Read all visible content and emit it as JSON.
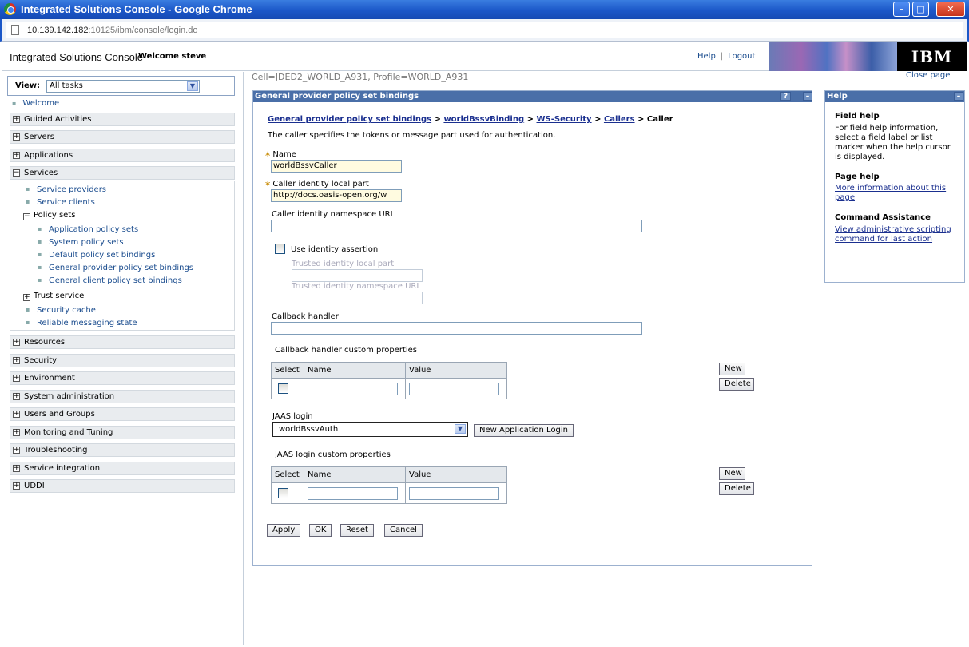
{
  "window": {
    "title": "Integrated Solutions Console - Google Chrome",
    "url_host": "10.139.142.182",
    "url_rest": ":10125/ibm/console/login.do",
    "minimize": "–",
    "maximize": "□",
    "close": "✕"
  },
  "header": {
    "brand": "Integrated Solutions Console",
    "welcome": "Welcome steve",
    "help_link": "Help",
    "separator": "|",
    "logout_link": "Logout",
    "ibm_logo": "IBM"
  },
  "nav": {
    "view_label": "View:",
    "view_value": "All tasks",
    "welcome": "Welcome",
    "groups": {
      "guided_activities": "Guided Activities",
      "servers": "Servers",
      "applications": "Applications",
      "services": "Services",
      "resources": "Resources",
      "security": "Security",
      "environment": "Environment",
      "system_administration": "System administration",
      "users_and_groups": "Users and Groups",
      "monitoring_and_tuning": "Monitoring and Tuning",
      "troubleshooting": "Troubleshooting",
      "service_integration": "Service integration",
      "uddi": "UDDI"
    },
    "expand_glyph": "+",
    "collapse_glyph": "−",
    "services_items": {
      "service_providers": "Service providers",
      "service_clients": "Service clients",
      "policy_sets": "Policy sets",
      "application_policy_sets": "Application policy sets",
      "system_policy_sets": "System policy sets",
      "default_policy_set_bindings": "Default policy set bindings",
      "general_provider_policy_set_bindings": "General provider policy set bindings",
      "general_client_policy_set_bindings": "General client policy set bindings",
      "trust_service": "Trust service",
      "security_cache": "Security cache",
      "reliable_messaging_state": "Reliable messaging state"
    }
  },
  "main": {
    "cell_profile": "Cell=JDED2_WORLD_A931, Profile=WORLD_A931",
    "close_page": "Close page",
    "panel_title": "General provider policy set bindings",
    "panel_help_btn": "?",
    "panel_min_btn": "–",
    "breadcrumb": {
      "b1": "General provider policy set bindings",
      "b2": "worldBssvBinding",
      "b3": "WS-Security",
      "b4": "Callers",
      "current": "Caller",
      "sep": ">"
    },
    "description": "The caller specifies the tokens or message part used for authentication.",
    "required_marker": "∗",
    "name_label": "Name",
    "name_value": "worldBssvCaller",
    "caller_local_part_label": "Caller identity local part",
    "caller_local_part_value": "http://docs.oasis-open.org/w",
    "caller_ns_label": "Caller identity namespace URI",
    "caller_ns_value": "",
    "use_identity_assertion": "Use identity assertion",
    "trusted_local_part_label": "Trusted identity local part",
    "trusted_ns_label": "Trusted identity namespace URI",
    "callback_handler_label": "Callback handler",
    "callback_handler_value": "",
    "callback_props_label": "Callback handler custom properties",
    "col_select": "Select",
    "col_name": "Name",
    "col_value": "Value",
    "new_button": "New",
    "delete_button": "Delete",
    "jaas_login_label": "JAAS login",
    "jaas_login_value": "worldBssvAuth",
    "new_app_login_button": "New Application Login",
    "jaas_props_label": "JAAS login custom properties",
    "apply": "Apply",
    "ok": "OK",
    "reset": "Reset",
    "cancel": "Cancel"
  },
  "help": {
    "title": "Help",
    "field_help_title": "Field help",
    "field_help_text": "For field help information, select a field label or list marker when the help cursor is displayed.",
    "page_help_title": "Page help",
    "page_help_link": "More information about this page",
    "command_title": "Command Assistance",
    "command_link": "View administrative scripting command for last action"
  }
}
